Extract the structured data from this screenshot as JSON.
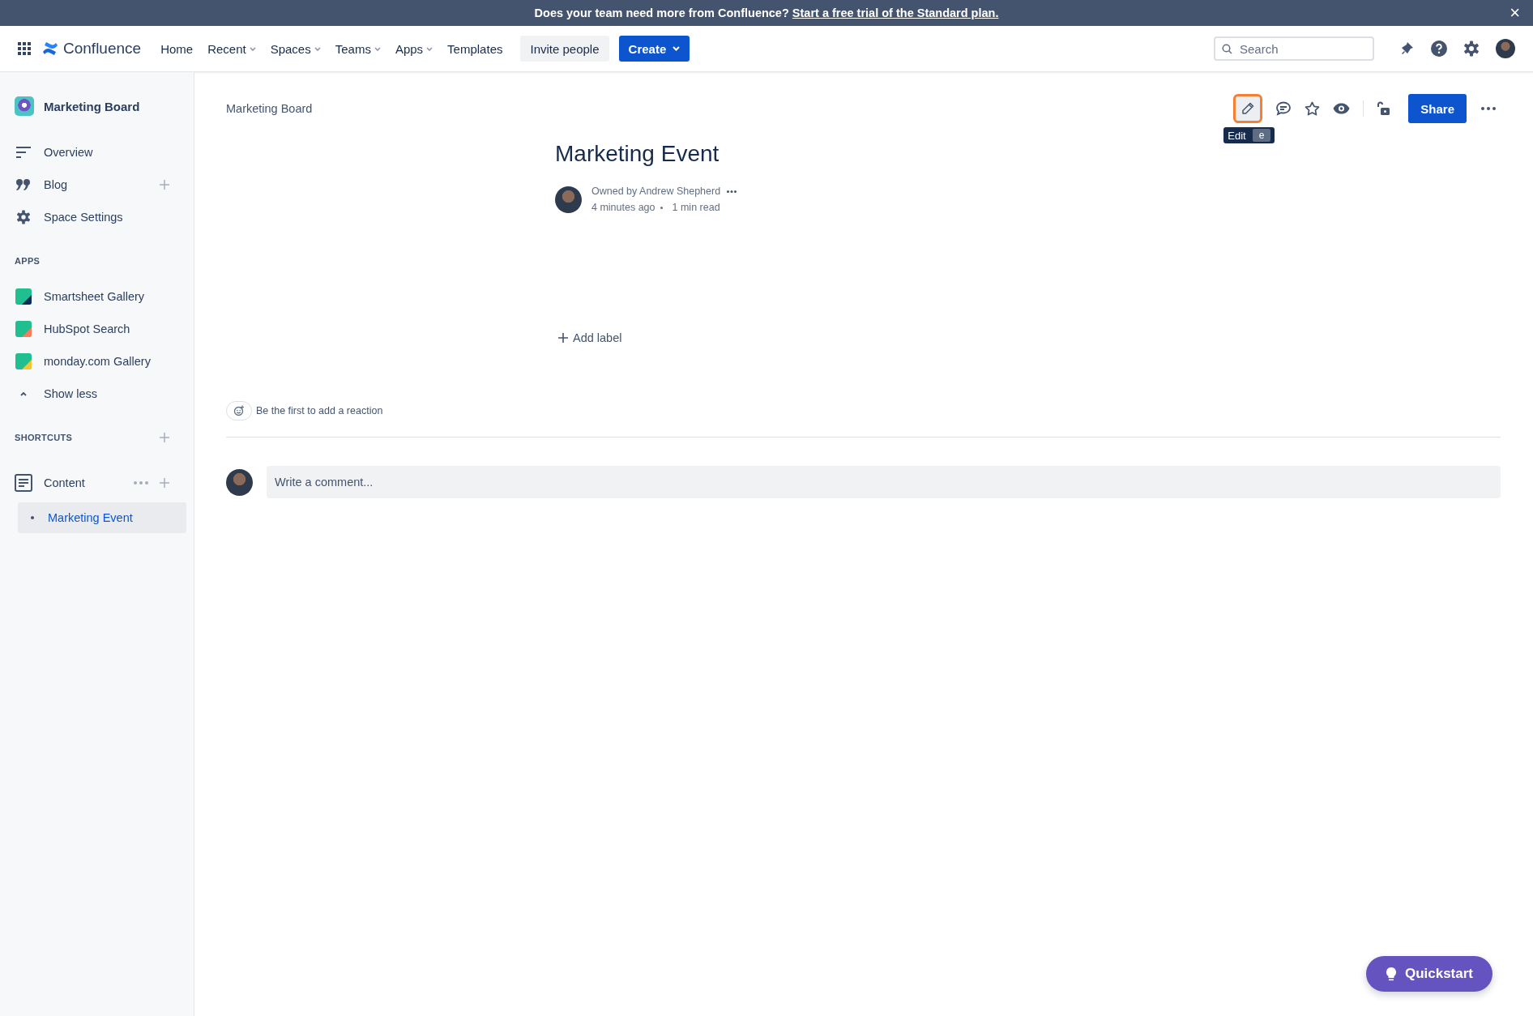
{
  "banner": {
    "text": "Does your team need more from Confluence?",
    "link": "Start a free trial of the Standard plan.",
    "close": "×"
  },
  "nav": {
    "product": "Confluence",
    "items": [
      {
        "label": "Home",
        "has_menu": false
      },
      {
        "label": "Recent",
        "has_menu": true
      },
      {
        "label": "Spaces",
        "has_menu": true
      },
      {
        "label": "Teams",
        "has_menu": true
      },
      {
        "label": "Apps",
        "has_menu": true
      },
      {
        "label": "Templates",
        "has_menu": false
      }
    ],
    "invite": "Invite people",
    "create": "Create",
    "search": {
      "placeholder": "Search"
    }
  },
  "sidebar": {
    "space": "Marketing Board",
    "items": [
      {
        "label": "Overview",
        "kind": "overview",
        "can_add": false
      },
      {
        "label": "Blog",
        "kind": "blog",
        "can_add": true
      },
      {
        "label": "Space Settings",
        "kind": "settings",
        "can_add": false
      }
    ],
    "apps_heading": "APPS",
    "apps": [
      {
        "label": "Smartsheet Gallery",
        "color": "#0b2d5b"
      },
      {
        "label": "HubSpot Search",
        "color": "#ff7a59"
      },
      {
        "label": "monday.com Gallery",
        "color": "#f8c42e"
      }
    ],
    "show_less": "Show less",
    "shortcuts_heading": "SHORTCUTS",
    "content": "Content",
    "pages": [
      {
        "label": "Marketing Event",
        "selected": true
      }
    ]
  },
  "page": {
    "breadcrumb": "Marketing Board",
    "actions": {
      "edit_focused": true,
      "tooltip": "Edit",
      "shortcut_key": "e",
      "share": "Share"
    },
    "title": "Marketing Event",
    "owner": "Owned by Andrew Shepherd",
    "updated": "4 minutes ago",
    "read_time": "1 min read",
    "add_label": "Add label",
    "reaction": "Be the first to add a reaction",
    "comment": {
      "placeholder": "Write a comment..."
    }
  },
  "quickstart": "Quickstart"
}
